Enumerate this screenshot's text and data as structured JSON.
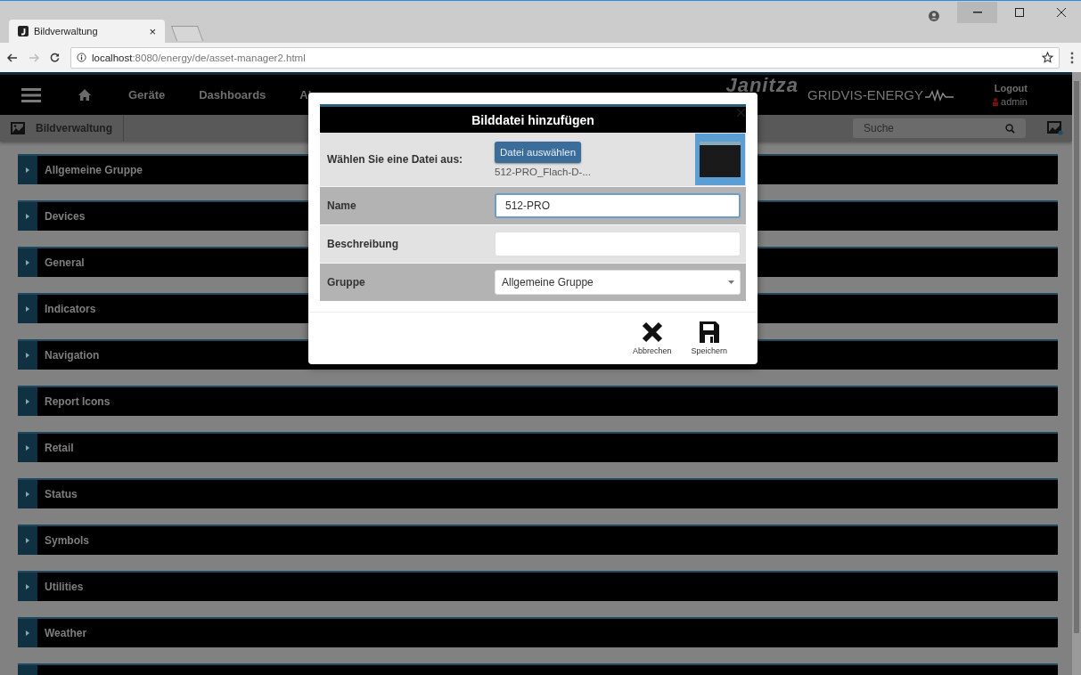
{
  "browser": {
    "tab": {
      "title": "Bildverwaltung",
      "close": "×"
    },
    "address": {
      "host": "localhost",
      "path": ":8080/energy/de/asset-manager2.html"
    }
  },
  "header": {
    "nav": [
      "Geräte",
      "Dashboards",
      "Al"
    ],
    "logo": "Janitza",
    "product": "GRIDVIS-ENERGY",
    "logout": "Logout",
    "user": "admin"
  },
  "subbar": {
    "title": "Bildverwaltung",
    "search": {
      "placeholder": "Suche"
    }
  },
  "groups": [
    {
      "label": "Allgemeine Gruppe",
      "expanded": false
    },
    {
      "label": "Devices",
      "expanded": false
    },
    {
      "label": "General",
      "expanded": false
    },
    {
      "label": "Indicators",
      "expanded": false
    },
    {
      "label": "Navigation",
      "expanded": false
    },
    {
      "label": "Report Icons",
      "expanded": false
    },
    {
      "label": "Retail",
      "expanded": false
    },
    {
      "label": "Status",
      "expanded": false
    },
    {
      "label": "Symbols",
      "expanded": false
    },
    {
      "label": "Utilities",
      "expanded": false
    },
    {
      "label": "Weather",
      "expanded": false
    }
  ],
  "dialog": {
    "title": "Bilddatei hinzufügen",
    "file": {
      "label": "Wählen Sie eine Datei aus:",
      "button": "Datei auswählen",
      "filename": "512-PRO_Flach-D-..."
    },
    "fields": [
      {
        "kind": "text",
        "label": "Name",
        "value": "512-PRO",
        "focused": true
      },
      {
        "kind": "text",
        "label": "Beschreibung",
        "focused": false
      },
      {
        "kind": "select",
        "label": "Gruppe",
        "value": "Allgemeine Gruppe",
        "focused": false
      }
    ],
    "actions": [
      {
        "kind": "cancel",
        "label": "Abbrechen"
      },
      {
        "kind": "save",
        "label": "Speichern"
      }
    ]
  }
}
